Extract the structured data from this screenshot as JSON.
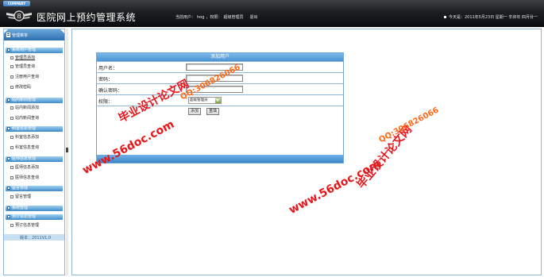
{
  "header": {
    "company_label": "COMPANY",
    "app_title": "医院网上预约管理系统",
    "user_prefix": "当前用户：",
    "user_name": "hog",
    "role_prefix": "，权限：",
    "role_name": "超级管理员",
    "logout_label": "退出",
    "date_text": "今天是：2011年5月23日 星期一 辛卯年 四月廿一"
  },
  "sidebar": {
    "title": "管理菜单",
    "groups": [
      {
        "label": "系统用户管理",
        "items": [
          "管理员添加",
          "管理员查询",
          "注册用户查询",
          "修改密码"
        ]
      },
      {
        "label": "站内新闻管理",
        "items": [
          "站内新闻添加",
          "站内新闻查询"
        ]
      },
      {
        "label": "科室信息管理",
        "items": [
          "科室信息添加",
          "科室信息查询"
        ]
      },
      {
        "label": "医师信息管理",
        "items": [
          "医师信息添加",
          "医师信息查询"
        ]
      },
      {
        "label": "留言管理",
        "items": [
          "留言管理"
        ]
      },
      {
        "label": "系统管理",
        "items": []
      },
      {
        "label": "预订信息管理",
        "items": [
          "预订信息管理"
        ]
      }
    ],
    "footer_text": "版本：2011V1.0"
  },
  "form": {
    "caption": "添加用户",
    "username_label": "用户名：",
    "password_label": "密码：",
    "confirm_label": "确认密码：",
    "role_label": "权限：",
    "username_value": "",
    "password_value": "",
    "confirm_value": "",
    "role_selected": "超级管理员",
    "add_button": "添加",
    "reset_button": "重填"
  },
  "watermarks": {
    "brand_cn": "毕业设计论文网",
    "site": "www.56doc.com",
    "qq": "QQ:306826066"
  },
  "colors": {
    "header_bg": "#1d1f21",
    "accent_blue": "#4b94d4",
    "watermark_red": "#e8161a",
    "watermark_orange": "#ff6a1a"
  }
}
